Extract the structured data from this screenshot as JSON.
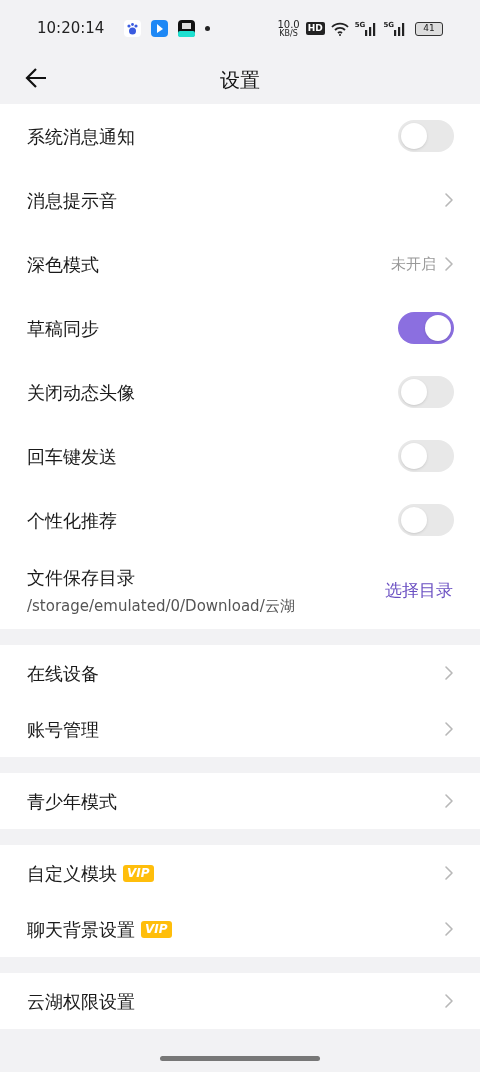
{
  "status_bar": {
    "time": "10:20:14",
    "net_speed": "10.0",
    "net_unit": "KB/S",
    "hd": "HD",
    "signals": [
      "5G",
      "5G"
    ],
    "battery": "41"
  },
  "header": {
    "title": "设置"
  },
  "groups": [
    {
      "items": [
        {
          "kind": "toggle",
          "label": "系统消息通知",
          "on": false
        },
        {
          "kind": "link",
          "label": "消息提示音"
        },
        {
          "kind": "value",
          "label": "深色模式",
          "value": "未开启"
        },
        {
          "kind": "toggle",
          "label": "草稿同步",
          "on": true
        },
        {
          "kind": "toggle",
          "label": "关闭动态头像",
          "on": false
        },
        {
          "kind": "toggle",
          "label": "回车键发送",
          "on": false
        },
        {
          "kind": "toggle",
          "label": "个性化推荐",
          "on": false
        },
        {
          "kind": "folder",
          "label": "文件保存目录",
          "path": "/storage/emulated/0/Download/云湖",
          "action": "选择目录"
        }
      ]
    },
    {
      "items": [
        {
          "kind": "link",
          "label": "在线设备"
        },
        {
          "kind": "link",
          "label": "账号管理"
        }
      ]
    },
    {
      "items": [
        {
          "kind": "link",
          "label": "青少年模式"
        }
      ]
    },
    {
      "items": [
        {
          "kind": "link",
          "label": "自定义模块",
          "badge": "VIP"
        },
        {
          "kind": "link",
          "label": "聊天背景设置",
          "badge": "VIP"
        }
      ]
    },
    {
      "items": [
        {
          "kind": "link",
          "label": "云湖权限设置"
        }
      ]
    }
  ]
}
